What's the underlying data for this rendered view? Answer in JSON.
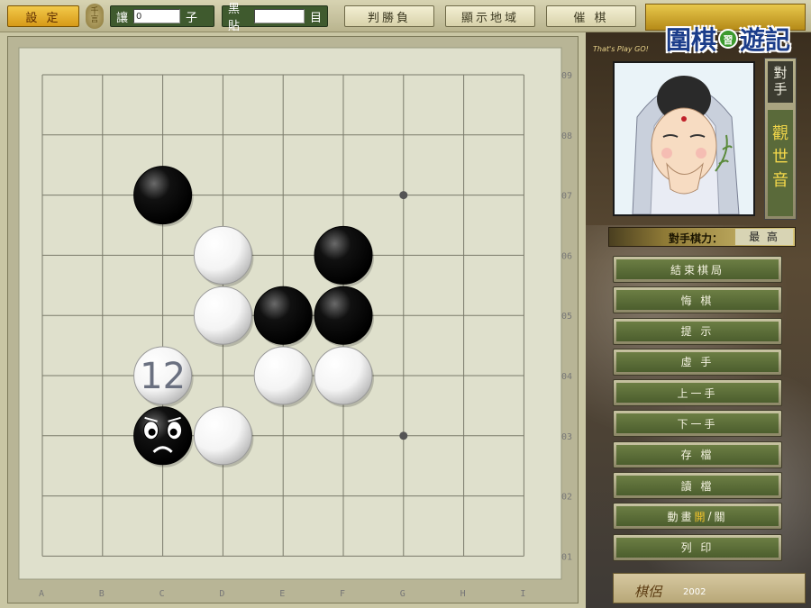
{
  "toolbar": {
    "settings_label": "設 定",
    "seal_text": [
      "千",
      "言"
    ],
    "handicap_label": "讓",
    "handicap_value": "0",
    "handicap_unit": "子",
    "komi_label": "黑貼",
    "komi_value": "",
    "komi_unit": "目",
    "judge_label": "判勝負",
    "territory_label": "顯示地域",
    "urge_label": "催 棋"
  },
  "header": {
    "logo_text_1": "圍棋",
    "logo_badge": "習",
    "logo_text_2": "遊記",
    "tagline": "That's Play GO!"
  },
  "opponent": {
    "tab_label": "對手",
    "name": "觀世音",
    "strength_label": "對手棋力：",
    "strength_value": "最 高"
  },
  "menu": {
    "items": [
      {
        "label": "結束棋局"
      },
      {
        "label": "悔 棋"
      },
      {
        "label": "提 示"
      },
      {
        "label": "虛 手"
      },
      {
        "label": "上一手"
      },
      {
        "label": "下一手"
      },
      {
        "label": "存 檔"
      },
      {
        "label": "讀 檔"
      },
      {
        "label_a": "動畫",
        "label_b": "開",
        "label_c": "/",
        "label_d": "關"
      },
      {
        "label": "列 印"
      }
    ]
  },
  "footer": {
    "signature": "棋侶",
    "year": "2002"
  },
  "board": {
    "size": 9,
    "col_labels": [
      "A",
      "B",
      "C",
      "D",
      "E",
      "F",
      "G",
      "H",
      "I"
    ],
    "row_labels": [
      "09",
      "08",
      "07",
      "06",
      "05",
      "04",
      "03",
      "02",
      "01"
    ],
    "star_points": [
      "G7",
      "G3"
    ],
    "stones": [
      {
        "pos": "C7",
        "color": "black"
      },
      {
        "pos": "D6",
        "color": "white"
      },
      {
        "pos": "F6",
        "color": "black"
      },
      {
        "pos": "D5",
        "color": "white"
      },
      {
        "pos": "E5",
        "color": "black"
      },
      {
        "pos": "F5",
        "color": "black"
      },
      {
        "pos": "C4",
        "color": "white",
        "label": "12"
      },
      {
        "pos": "E4",
        "color": "white"
      },
      {
        "pos": "F4",
        "color": "white"
      },
      {
        "pos": "C3",
        "color": "black",
        "face": "sad"
      },
      {
        "pos": "D3",
        "color": "white"
      }
    ]
  },
  "colors": {
    "board_bg": "#dfe0cc",
    "grid_line": "#7a7a6a",
    "black_stone": "#111111",
    "white_stone": "#f4f4f4"
  }
}
